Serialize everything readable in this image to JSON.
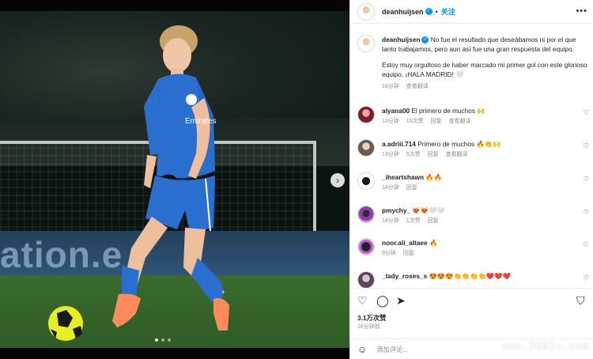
{
  "post_header": {
    "username": "deanhuijsen",
    "separator": "•",
    "follow_label": "关注",
    "more_icon": "more-horizontal-icon"
  },
  "caption": {
    "username": "deanhuijsen",
    "text1": "No fue el resultado que deseábamos ni por el que tanto trabajamos, pero aun así fue una gran respuesta del equipo.",
    "text2": "Estoy muy orgulloso de haber marcado mi primer gol con este glorioso equipo. ¡HALA MADRID! 🤍",
    "time": "16分钟",
    "translate": "查看翻译"
  },
  "comments": [
    {
      "username": "alyana00",
      "text": "El primero de muchos 🙌",
      "time": "13分钟",
      "likes": "15次赞",
      "reply": "回复",
      "translate": "查看翻译"
    },
    {
      "username": "a.adriii.714",
      "text": "Primero de muchos 🔥👏🙌",
      "time": "13分钟",
      "likes": "5次赞",
      "reply": "回复",
      "translate": "查看翻译"
    },
    {
      "username": "_iheartshawn",
      "text": "🔥🔥",
      "time": "14分钟",
      "likes": "",
      "reply": "回复",
      "translate": ""
    },
    {
      "username": "pmychy_",
      "text": "😻😻🤍🤍",
      "time": "14分钟",
      "likes": "1次赞",
      "reply": "回复",
      "translate": ""
    },
    {
      "username": "noor.ali_altaee",
      "text": "🔥",
      "time": "9分钟",
      "likes": "",
      "reply": "回复",
      "translate": ""
    },
    {
      "username": "_lady_roses_s",
      "text": "😍😍😍👏👏👏👏❤️❤️❤️",
      "time": "",
      "likes": "",
      "reply": "",
      "translate": ""
    }
  ],
  "actions": {
    "like_icon": "heart-icon",
    "comment_icon": "comment-icon",
    "share_icon": "share-icon",
    "save_icon": "bookmark-icon"
  },
  "likes": "3.1万次赞",
  "posted_ago": "16分钟前",
  "add_comment_placeholder": "添加评论...",
  "photo_board_text": "ation.e",
  "watermark": "www.365jz.com",
  "colors": {
    "accent": "#0095f6",
    "text": "#262626",
    "muted": "#8e8e8e"
  }
}
